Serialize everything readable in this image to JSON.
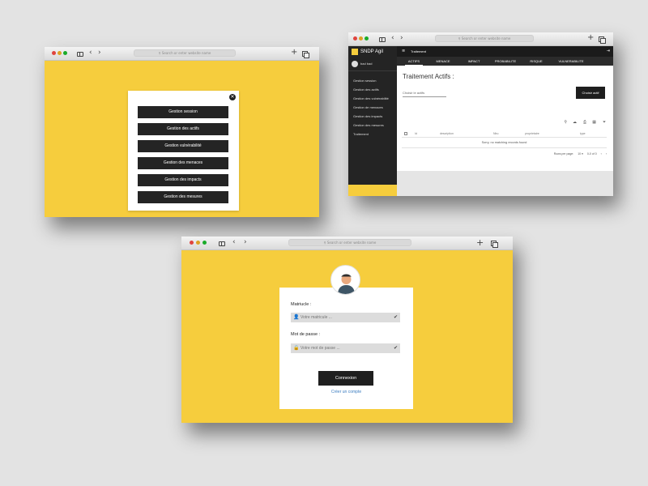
{
  "browser": {
    "address_placeholder": "Search or enter website name",
    "search_glyph": "⚲",
    "back_glyph": "‹",
    "forward_glyph": "›",
    "new_tab_glyph": "+"
  },
  "window1": {
    "close_glyph": "✕",
    "menu_items": [
      "Gestion session",
      "Gestion des actifs",
      "Gestion vulnérabilité",
      "Gestion des menaces",
      "Gestion des impacts",
      "Gestion des mesures"
    ]
  },
  "window2": {
    "app_name": "SNDP Agil",
    "user_name": "bad bad",
    "hamburger_glyph": "≡",
    "exit_glyph": "⇥",
    "page_header": "Traitement",
    "sidebar_items": [
      "Gestion session",
      "Gestion des actifs",
      "Gestion des vulnérabilité",
      "Gestion de menaces",
      "Gestion des impacts",
      "Gestion des mesures",
      "Traitement"
    ],
    "tabs": [
      "ACTIFS",
      "MENACE",
      "IMPACT",
      "PROBABILITE",
      "RISQUE",
      "VULNERABILITE"
    ],
    "active_tab": "ACTIFS",
    "section_title": "Traitement Actifs :",
    "select_placeholder": "Choisir le actifs",
    "choose_button": "Choisir actif",
    "toolbar_icons": [
      "search-icon",
      "download-icon",
      "print-icon",
      "view-columns-icon",
      "filter-icon"
    ],
    "toolbar_glyphs": [
      "⚲",
      "☁",
      "⎙",
      "▦",
      "⏷"
    ],
    "table_headers": [
      "Id",
      "description",
      "Nbu",
      "proprietaire",
      "type"
    ],
    "empty_message": "Sorry, no matching records found",
    "rows_per_page_label": "Rows per page:",
    "rows_per_page_value": "10 ▾",
    "page_range": "0-0 of 0",
    "prev_glyph": "‹",
    "next_glyph": "›"
  },
  "window3": {
    "matricule_label": "Matriucle :",
    "matricule_placeholder": "Votre matricule ...",
    "password_label": "Mot de passe :",
    "password_placeholder": "Votre mot de passe ...",
    "user_glyph": "👤",
    "lock_glyph": "🔒",
    "check_glyph": "✔",
    "login_button": "Connexion",
    "create_account_link": "Créer un compte"
  },
  "colors": {
    "accent_yellow": "#f6cd3d",
    "dark": "#242424",
    "link_blue": "#3a7cc0"
  }
}
